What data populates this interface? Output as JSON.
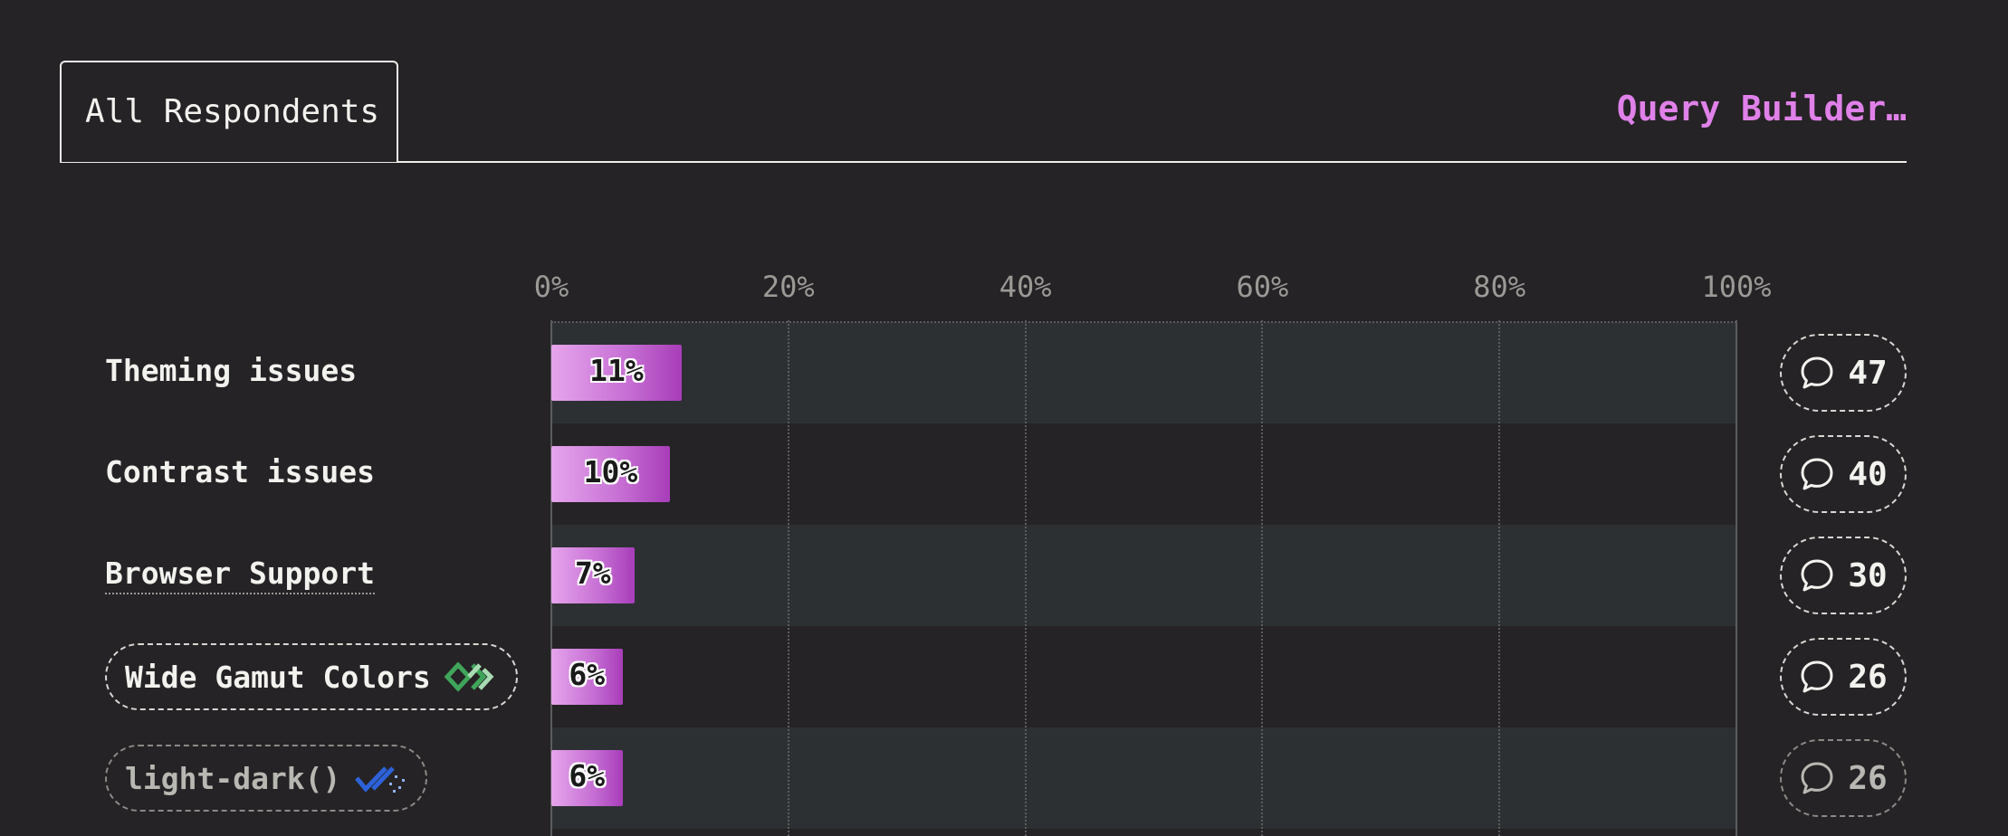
{
  "header": {
    "tab_label": "All Respondents",
    "query_builder_label": "Query Builder…"
  },
  "chart_data": {
    "type": "bar",
    "orientation": "horizontal",
    "x_ticks": [
      "0%",
      "20%",
      "40%",
      "60%",
      "80%",
      "100%"
    ],
    "xlim": [
      0,
      100
    ],
    "categories": [
      "Theming issues",
      "Contrast issues",
      "Browser Support",
      "Wide Gamut Colors",
      "light-dark()"
    ],
    "values": [
      11,
      10,
      7,
      6,
      6
    ],
    "value_labels": [
      "11%",
      "10%",
      "7%",
      "6%",
      "6%"
    ],
    "comment_counts": [
      "47",
      "40",
      "30",
      "26",
      "26"
    ],
    "bar_color": "#c56dd3",
    "grid": true
  },
  "icons": {
    "comment": "speech-bubble-icon",
    "wide_gamut": "baseline-widely-available-icon",
    "light_dark": "baseline-newly-available-icon"
  },
  "colors": {
    "background": "#252325",
    "accent": "#e081e9",
    "row_alt": "#2d3033"
  }
}
